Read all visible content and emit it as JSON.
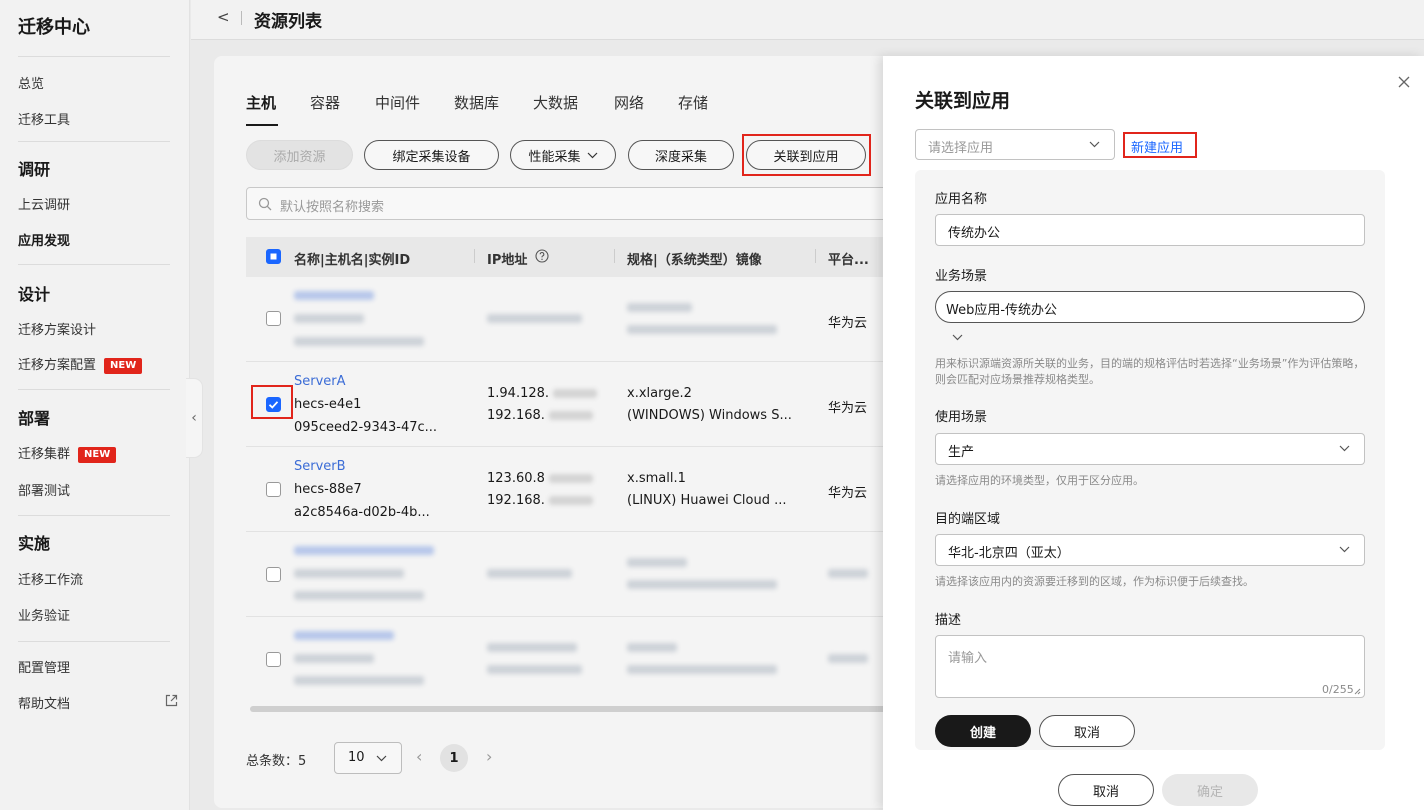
{
  "sidebar": {
    "title": "迁移中心",
    "overview": "总览",
    "tools": "迁移工具",
    "groups": {
      "survey": "调研",
      "design": "设计",
      "deploy": "部署",
      "implement": "实施"
    },
    "items": {
      "cloud_survey": "上云调研",
      "app_discovery": "应用发现",
      "plan_design": "迁移方案设计",
      "plan_config": "迁移方案配置",
      "cluster": "迁移集群",
      "deploy_test": "部署测试",
      "workflow": "迁移工作流",
      "verify": "业务验证",
      "config_mgmt": "配置管理",
      "help_docs": "帮助文档"
    },
    "new_badge": "NEW"
  },
  "header": {
    "title": "资源列表"
  },
  "tabs": [
    "主机",
    "容器",
    "中间件",
    "数据库",
    "大数据",
    "网络",
    "存储"
  ],
  "toolbar": {
    "add_resource": "添加资源",
    "bind_device": "绑定采集设备",
    "perf_collect": "性能采集",
    "deep_collect": "深度采集",
    "link_app": "关联到应用"
  },
  "search": {
    "placeholder": "默认按照名称搜索"
  },
  "table": {
    "headers": {
      "name": "名称|主机名|实例ID",
      "ip": "IP地址",
      "spec": "规格|（系统类型）镜像",
      "platform": "平台..."
    },
    "rows": [
      {
        "platform": "华为云"
      },
      {
        "name": "ServerA",
        "hostname": "hecs-e4e1",
        "instance_id": "095ceed2-9343-47c...",
        "ip1": "1.94.128.",
        "ip2": "192.168.",
        "spec": "x.xlarge.2",
        "image": "(WINDOWS) Windows S...",
        "platform": "华为云",
        "checked": true
      },
      {
        "name": "ServerB",
        "hostname": "hecs-88e7",
        "instance_id": "a2c8546a-d02b-4b...",
        "ip1": "123.60.8",
        "ip2": "192.168.",
        "spec": "x.small.1",
        "image": "(LINUX) Huawei Cloud ...",
        "platform": "华为云",
        "checked": false
      }
    ]
  },
  "pagination": {
    "total": "总条数：5",
    "page_size": "10",
    "current": "1"
  },
  "drawer": {
    "title": "关联到应用",
    "select_placeholder": "请选择应用",
    "new_app": "新建应用",
    "app_name_label": "应用名称",
    "app_name_value": "传统办公",
    "biz_scene_label": "业务场景",
    "biz_scene_value": "Web应用-传统办公",
    "biz_scene_hint": "用来标识源端资源所关联的业务，目的端的规格评估时若选择“业务场景”作为评估策略，则会匹配对应场景推荐规格类型。",
    "usage_label": "使用场景",
    "usage_value": "生产",
    "usage_hint": "请选择应用的环境类型，仅用于区分应用。",
    "region_label": "目的端区域",
    "region_value": "华北-北京四（亚太）",
    "region_hint": "请选择该应用内的资源要迁移到的区域，作为标识便于后续查找。",
    "desc_label": "描述",
    "desc_placeholder": "请输入",
    "desc_count": "0/255",
    "create": "创建",
    "cancel_inner": "取消",
    "cancel": "取消",
    "confirm": "确定"
  }
}
